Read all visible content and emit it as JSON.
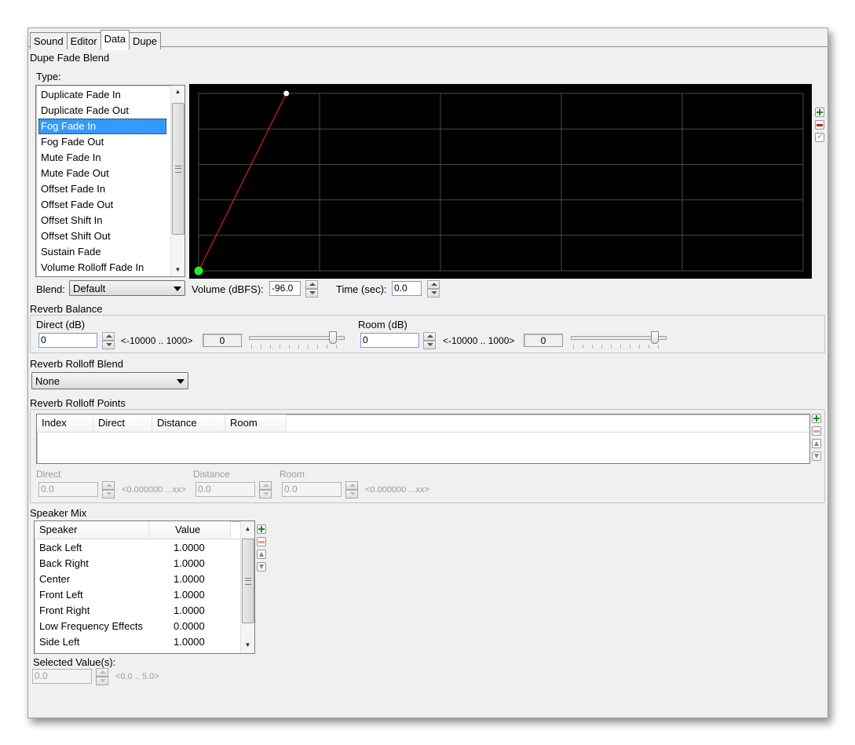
{
  "tabs": [
    "Sound",
    "Editor",
    "Data",
    "Dupe"
  ],
  "active_tab": "Data",
  "dupe_fade_blend": {
    "section_label": "Dupe Fade Blend",
    "type_label": "Type:",
    "types": [
      "Duplicate Fade In",
      "Duplicate Fade Out",
      "Fog Fade In",
      "Fog Fade Out",
      "Mute Fade In",
      "Mute Fade Out",
      "Offset Fade In",
      "Offset Fade Out",
      "Offset Shift In",
      "Offset Shift Out",
      "Sustain Fade",
      "Volume Rolloff Fade In"
    ],
    "selected_type": "Fog Fade In",
    "blend_label": "Blend:",
    "blend_value": "Default",
    "volume_label": "Volume (dBFS):",
    "volume_value": "-96.0",
    "time_label": "Time (sec):",
    "time_value": "0.0",
    "graph": {
      "background": "#000000",
      "grid_color": "#4a4a4a",
      "line_color": "#ff2020",
      "start_point_color": "#22ee22",
      "end_point_color": "#ffffff",
      "points": [
        {
          "t": 0.0,
          "v": 0.0
        },
        {
          "t": 0.145,
          "v": 1.0
        }
      ]
    }
  },
  "reverb_balance": {
    "section_label": "Reverb Balance",
    "direct": {
      "label": "Direct (dB)",
      "value": "0",
      "range": "<-10000 .. 1000>",
      "readout": "0",
      "slider_fraction": 0.91
    },
    "room": {
      "label": "Room (dB)",
      "value": "0",
      "range": "<-10000 .. 1000>",
      "readout": "0",
      "slider_fraction": 0.91
    }
  },
  "reverb_rolloff_blend": {
    "section_label": "Reverb Rolloff Blend",
    "value": "None"
  },
  "reverb_rolloff_points": {
    "section_label": "Reverb Rolloff Points",
    "columns": [
      "Index",
      "Direct",
      "Distance",
      "Room"
    ],
    "direct_label": "Direct",
    "direct_value": "0.0",
    "direct_range": "<0.000000 ...xx>",
    "distance_label": "Distance",
    "distance_value": "0.0",
    "room_label": "Room",
    "room_value": "0.0",
    "room_range": "<0.000000 ...xx>"
  },
  "speaker_mix": {
    "section_label": "Speaker Mix",
    "columns": [
      "Speaker",
      "Value"
    ],
    "rows": [
      {
        "speaker": "Back Left",
        "value": "1.0000"
      },
      {
        "speaker": "Back Right",
        "value": "1.0000"
      },
      {
        "speaker": "Center",
        "value": "1.0000"
      },
      {
        "speaker": "Front Left",
        "value": "1.0000"
      },
      {
        "speaker": "Front Right",
        "value": "1.0000"
      },
      {
        "speaker": "Low Frequency Effects",
        "value": "0.0000"
      },
      {
        "speaker": "Side Left",
        "value": "1.0000"
      }
    ],
    "selected_values_label": "Selected Value(s):",
    "selected_value": "0.0",
    "selected_range": "<0.0 .. 5.0>"
  }
}
